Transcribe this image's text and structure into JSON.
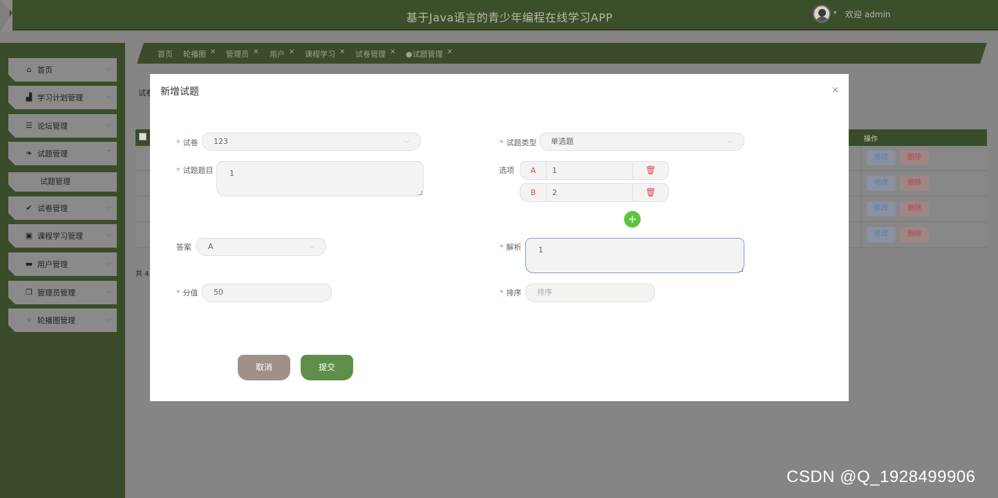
{
  "header": {
    "title": "基于Java语言的青少年编程在线学习APP",
    "welcome": "欢迎 admin"
  },
  "sidebar": {
    "items": [
      {
        "label": "首页",
        "icon": "home-icon"
      },
      {
        "label": "学习计划管理",
        "icon": "building-icon"
      },
      {
        "label": "论坛管理",
        "icon": "server-icon"
      },
      {
        "label": "试题管理",
        "icon": "leaf-icon"
      },
      {
        "label": "试卷管理",
        "icon": "check-circle-icon"
      },
      {
        "label": "课程学习管理",
        "icon": "briefcase-icon"
      },
      {
        "label": "用户管理",
        "icon": "monitor-icon"
      },
      {
        "label": "管理员管理",
        "icon": "files-icon"
      },
      {
        "label": "轮播图管理",
        "icon": "grid-icon"
      }
    ],
    "sub_item": "试题管理"
  },
  "tabs": [
    {
      "label": "首页",
      "closable": false
    },
    {
      "label": "轮播图",
      "closable": true
    },
    {
      "label": "管理员",
      "closable": true
    },
    {
      "label": "用户",
      "closable": true
    },
    {
      "label": "课程学习",
      "closable": true
    },
    {
      "label": "试卷管理",
      "closable": true
    },
    {
      "label": "●试题管理",
      "closable": true
    }
  ],
  "background": {
    "label": "试卷",
    "op_header": "操作",
    "edit": "修改",
    "delete": "删除",
    "total": "共 4"
  },
  "modal": {
    "title": "新增试题",
    "close": "×",
    "paper_label": "试卷",
    "paper_value": "123",
    "type_label": "试题类型",
    "type_value": "单选题",
    "question_label": "试题题目",
    "question_value": "1",
    "options_label": "选项",
    "options": [
      {
        "key": "A",
        "value": "1"
      },
      {
        "key": "B",
        "value": "2"
      }
    ],
    "answer_label": "答案",
    "answer_value": "A",
    "analysis_label": "解析",
    "analysis_value": "1",
    "score_label": "分值",
    "score_value": "50",
    "order_label": "排序",
    "order_placeholder": "排序",
    "cancel": "取消",
    "submit": "提交"
  },
  "watermark": "CSDN @Q_1928499906",
  "colors": {
    "primary_green": "#3a4c2a",
    "submit_green": "#5e8f4a",
    "cancel_brown": "#a0908a",
    "danger_red": "#e3465a",
    "add_green": "#5fc43c"
  }
}
